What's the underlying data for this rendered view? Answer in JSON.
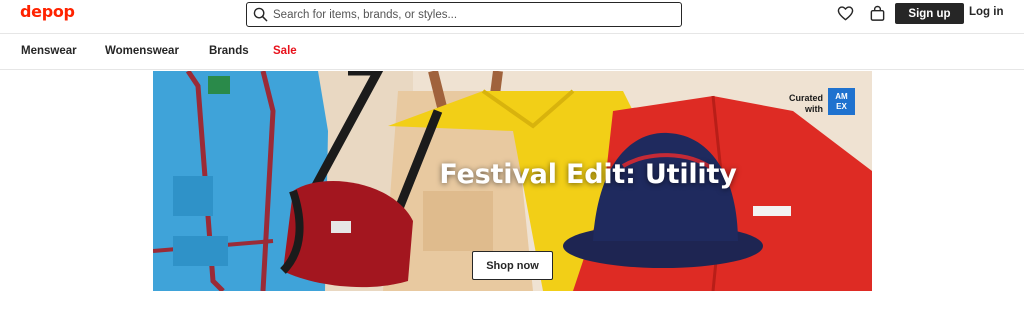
{
  "header": {
    "logo": "depop",
    "search": {
      "placeholder": "Search for items, brands, or styles..."
    },
    "icons": {
      "heart": "heart-icon",
      "bag": "bag-icon",
      "search": "search-icon"
    },
    "signup_label": "Sign up",
    "login_label": "Log in"
  },
  "nav": {
    "items": [
      {
        "label": "Menswear"
      },
      {
        "label": "Womenswear"
      },
      {
        "label": "Brands"
      },
      {
        "label": "Sale",
        "color": "#e8111b"
      }
    ]
  },
  "hero": {
    "title": "Festival Edit: Utility",
    "button_label": "Shop now",
    "curated_line1": "Curated",
    "curated_line2": "with",
    "amex_line1": "AM",
    "amex_line2": "EX"
  },
  "colors": {
    "brand": "#ff2300",
    "dark": "#262626",
    "sale": "#e8111b",
    "amex": "#1f72cf"
  }
}
